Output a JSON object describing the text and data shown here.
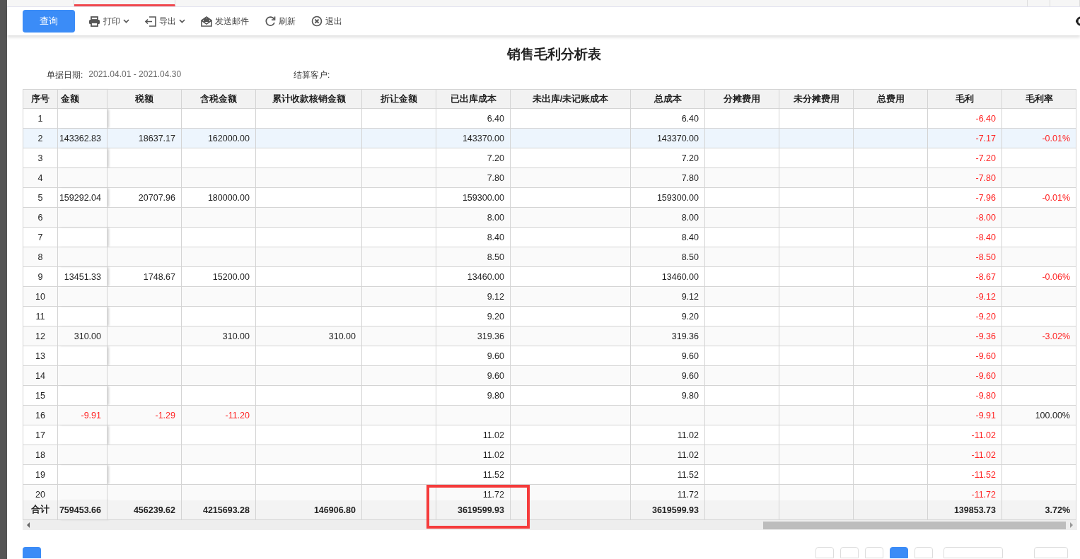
{
  "top_tabs": [
    {
      "selected": false
    },
    {
      "selected": true
    },
    {
      "selected": false
    },
    {
      "selected": false
    },
    {
      "selected": false
    }
  ],
  "toolbar": [
    {
      "label": "查询",
      "kind": "primary",
      "has_menu": false
    },
    {
      "label": "打印",
      "kind": "print",
      "has_menu": true
    },
    {
      "label": "导出",
      "kind": "export",
      "has_menu": true
    },
    {
      "label": "发送邮件",
      "kind": "mail",
      "has_menu": false
    },
    {
      "label": "刷新",
      "kind": "refresh",
      "has_menu": false
    },
    {
      "label": "退出",
      "kind": "exit",
      "has_menu": false
    }
  ],
  "report": {
    "title": "销售毛利分析表",
    "filters": [
      {
        "label": "单据日期:",
        "value": "2021.04.01 - 2021.04.30"
      },
      {
        "label": "结算客户:"
      }
    ]
  },
  "table": {
    "columns": [
      "序号",
      "金额",
      "税额",
      "含税金额",
      "累计收款核销金额",
      "折让金额",
      "已出库成本",
      "未出库/未记账成本",
      "总成本",
      "分摊费用",
      "未分摊费用",
      "总费用",
      "毛利",
      "毛利率"
    ],
    "rows": [
      {
        "selected": false,
        "cells": [
          "1",
          "",
          "",
          "",
          "",
          "",
          "6.40",
          "",
          "6.40",
          "",
          "",
          "",
          {
            "text": "-6.40",
            "negative": true
          },
          ""
        ]
      },
      {
        "selected": true,
        "cells": [
          "2",
          "143362.83",
          "18637.17",
          "162000.00",
          "",
          "",
          "143370.00",
          "",
          "143370.00",
          "",
          "",
          "",
          {
            "text": "-7.17",
            "negative": true
          },
          {
            "text": "-0.01%",
            "negative": true
          }
        ]
      },
      {
        "selected": false,
        "cells": [
          "3",
          "",
          "",
          "",
          "",
          "",
          "7.20",
          "",
          "7.20",
          "",
          "",
          "",
          {
            "text": "-7.20",
            "negative": true
          },
          ""
        ]
      },
      {
        "selected": false,
        "cells": [
          "4",
          "",
          "",
          "",
          "",
          "",
          "7.80",
          "",
          "7.80",
          "",
          "",
          "",
          {
            "text": "-7.80",
            "negative": true
          },
          ""
        ]
      },
      {
        "selected": false,
        "cells": [
          "5",
          "159292.04",
          "20707.96",
          "180000.00",
          "",
          "",
          "159300.00",
          "",
          "159300.00",
          "",
          "",
          "",
          {
            "text": "-7.96",
            "negative": true
          },
          {
            "text": "-0.01%",
            "negative": true
          }
        ]
      },
      {
        "selected": false,
        "cells": [
          "6",
          "",
          "",
          "",
          "",
          "",
          "8.00",
          "",
          "8.00",
          "",
          "",
          "",
          {
            "text": "-8.00",
            "negative": true
          },
          ""
        ]
      },
      {
        "selected": false,
        "cells": [
          "7",
          "",
          "",
          "",
          "",
          "",
          "8.40",
          "",
          "8.40",
          "",
          "",
          "",
          {
            "text": "-8.40",
            "negative": true
          },
          ""
        ]
      },
      {
        "selected": false,
        "cells": [
          "8",
          "",
          "",
          "",
          "",
          "",
          "8.50",
          "",
          "8.50",
          "",
          "",
          "",
          {
            "text": "-8.50",
            "negative": true
          },
          ""
        ]
      },
      {
        "selected": false,
        "cells": [
          "9",
          "13451.33",
          "1748.67",
          "15200.00",
          "",
          "",
          "13460.00",
          "",
          "13460.00",
          "",
          "",
          "",
          {
            "text": "-8.67",
            "negative": true
          },
          {
            "text": "-0.06%",
            "negative": true
          }
        ]
      },
      {
        "selected": false,
        "cells": [
          "10",
          "",
          "",
          "",
          "",
          "",
          "9.12",
          "",
          "9.12",
          "",
          "",
          "",
          {
            "text": "-9.12",
            "negative": true
          },
          ""
        ]
      },
      {
        "selected": false,
        "cells": [
          "11",
          "",
          "",
          "",
          "",
          "",
          "9.20",
          "",
          "9.20",
          "",
          "",
          "",
          {
            "text": "-9.20",
            "negative": true
          },
          ""
        ]
      },
      {
        "selected": false,
        "cells": [
          "12",
          "310.00",
          "",
          "310.00",
          "310.00",
          "",
          "319.36",
          "",
          "319.36",
          "",
          "",
          "",
          {
            "text": "-9.36",
            "negative": true
          },
          {
            "text": "-3.02%",
            "negative": true
          }
        ]
      },
      {
        "selected": false,
        "cells": [
          "13",
          "",
          "",
          "",
          "",
          "",
          "9.60",
          "",
          "9.60",
          "",
          "",
          "",
          {
            "text": "-9.60",
            "negative": true
          },
          ""
        ]
      },
      {
        "selected": false,
        "cells": [
          "14",
          "",
          "",
          "",
          "",
          "",
          "9.60",
          "",
          "9.60",
          "",
          "",
          "",
          {
            "text": "-9.60",
            "negative": true
          },
          ""
        ]
      },
      {
        "selected": false,
        "cells": [
          "15",
          "",
          "",
          "",
          "",
          "",
          "9.80",
          "",
          "9.80",
          "",
          "",
          "",
          {
            "text": "-9.80",
            "negative": true
          },
          ""
        ]
      },
      {
        "selected": false,
        "cells": [
          "16",
          {
            "text": "-9.91",
            "negative": true
          },
          {
            "text": "-1.29",
            "negative": true
          },
          {
            "text": "-11.20",
            "negative": true
          },
          "",
          "",
          "",
          "",
          "",
          "",
          "",
          "",
          {
            "text": "-9.91",
            "negative": true
          },
          "100.00%"
        ]
      },
      {
        "selected": false,
        "cells": [
          "17",
          "",
          "",
          "",
          "",
          "",
          "11.02",
          "",
          "11.02",
          "",
          "",
          "",
          {
            "text": "-11.02",
            "negative": true
          },
          ""
        ]
      },
      {
        "selected": false,
        "cells": [
          "18",
          "",
          "",
          "",
          "",
          "",
          "11.02",
          "",
          "11.02",
          "",
          "",
          "",
          {
            "text": "-11.02",
            "negative": true
          },
          ""
        ]
      },
      {
        "selected": false,
        "cells": [
          "19",
          "",
          "",
          "",
          "",
          "",
          "11.52",
          "",
          "11.52",
          "",
          "",
          "",
          {
            "text": "-11.52",
            "negative": true
          },
          ""
        ]
      },
      {
        "selected": false,
        "cells": [
          "20",
          "",
          "",
          "",
          "",
          "",
          "11.72",
          "",
          "11.72",
          "",
          "",
          "",
          {
            "text": "-11.72",
            "negative": true
          },
          ""
        ]
      }
    ],
    "total": {
      "cells": [
        "合计",
        "759453.66",
        "456239.62",
        "4215693.28",
        "146906.80",
        "",
        "3619599.93",
        "",
        "3619599.93",
        "",
        "",
        "",
        "139853.73",
        "3.72%"
      ]
    }
  },
  "pager": [
    {
      "selected": false
    },
    {
      "selected": false
    },
    {
      "selected": false
    },
    {
      "selected": true
    },
    {
      "selected": false
    }
  ]
}
